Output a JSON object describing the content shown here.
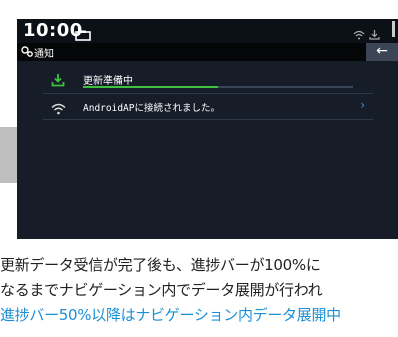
{
  "status_bar": {
    "time": "10:00"
  },
  "title_bar": {
    "label": "通知",
    "back_icon": "←"
  },
  "notifications": [
    {
      "title": "更新準備中",
      "icon": "download-icon",
      "progress": 0.5
    },
    {
      "title": "AndroidAPに接続されました。",
      "icon": "wifi-icon",
      "action_icon": "›"
    }
  ],
  "caption": {
    "line1": "更新データ受信が完了後も、進捗バーが100%に",
    "line2": "なるまでナビゲーション内でデータ展開が行われ",
    "line3": "進捗バー50%以降はナビゲーション内データ展開中"
  },
  "colors": {
    "accent_green": "#3ec23e",
    "accent_blue": "#3c8de0",
    "caption_blue": "#1d8fd6"
  }
}
